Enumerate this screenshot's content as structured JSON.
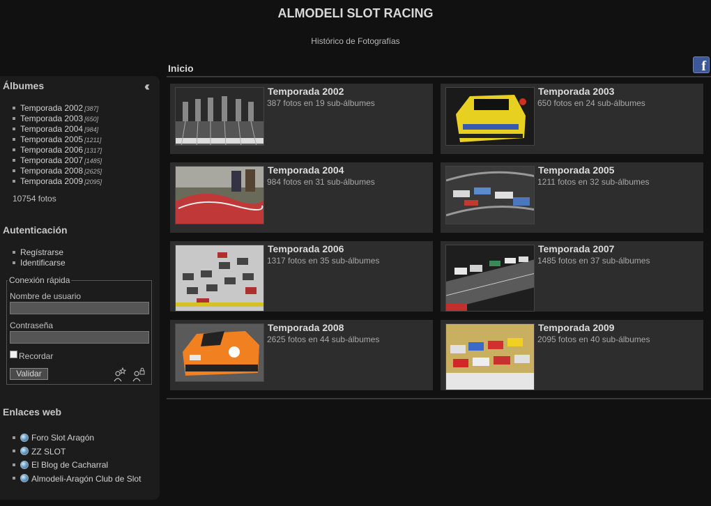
{
  "header": {
    "title": "ALMODELI SLOT RACING",
    "subtitle": "Histórico de Fotografías"
  },
  "sidebar": {
    "albums_heading": "Álbumes",
    "albums": [
      {
        "label": "Temporada 2002",
        "count": "[387]"
      },
      {
        "label": "Temporada 2003",
        "count": "[650]"
      },
      {
        "label": "Temporada 2004",
        "count": "[984]"
      },
      {
        "label": "Temporada 2005",
        "count": "[1211]"
      },
      {
        "label": "Temporada 2006",
        "count": "[1317]"
      },
      {
        "label": "Temporada 2007",
        "count": "[1485]"
      },
      {
        "label": "Temporada 2008",
        "count": "[2625]"
      },
      {
        "label": "Temporada 2009",
        "count": "[2095]"
      }
    ],
    "total_photos": "10754 fotos",
    "auth_heading": "Autenticación",
    "auth_links": [
      "Regístrarse",
      "Identificarse"
    ],
    "quick_login": {
      "legend": "Conexión rápida",
      "username_label": "Nombre de usuario",
      "username_value": "",
      "password_label": "Contraseña",
      "password_value": "",
      "remember_label": "Recordar",
      "remember_checked": false,
      "submit_label": "Validar"
    },
    "links_heading": "Enlaces web",
    "web_links": [
      "Foro Slot Aragón",
      "ZZ SLOT",
      "El Blog de Cacharral",
      "Almodeli-Aragón Club de Slot"
    ]
  },
  "main": {
    "breadcrumb": "Inicio",
    "albums": [
      {
        "name": "Temporada 2002",
        "info": "387 fotos en 19 sub-álbumes"
      },
      {
        "name": "Temporada 2003",
        "info": "650 fotos en 24 sub-álbumes"
      },
      {
        "name": "Temporada 2004",
        "info": "984 fotos en 31 sub-álbumes"
      },
      {
        "name": "Temporada 2005",
        "info": "1211 fotos en 32 sub-álbumes"
      },
      {
        "name": "Temporada 2006",
        "info": "1317 fotos en 35 sub-álbumes"
      },
      {
        "name": "Temporada 2007",
        "info": "1485 fotos en 37 sub-álbumes"
      },
      {
        "name": "Temporada 2008",
        "info": "2625 fotos en 44 sub-álbumes"
      },
      {
        "name": "Temporada 2009",
        "info": "2095 fotos en 40 sub-álbumes"
      }
    ]
  },
  "icons": {
    "facebook": "facebook-icon",
    "collapse": "double-chevron-left-icon",
    "web_link": "globe-icon",
    "register": "user-star-icon",
    "login": "user-lock-icon"
  }
}
